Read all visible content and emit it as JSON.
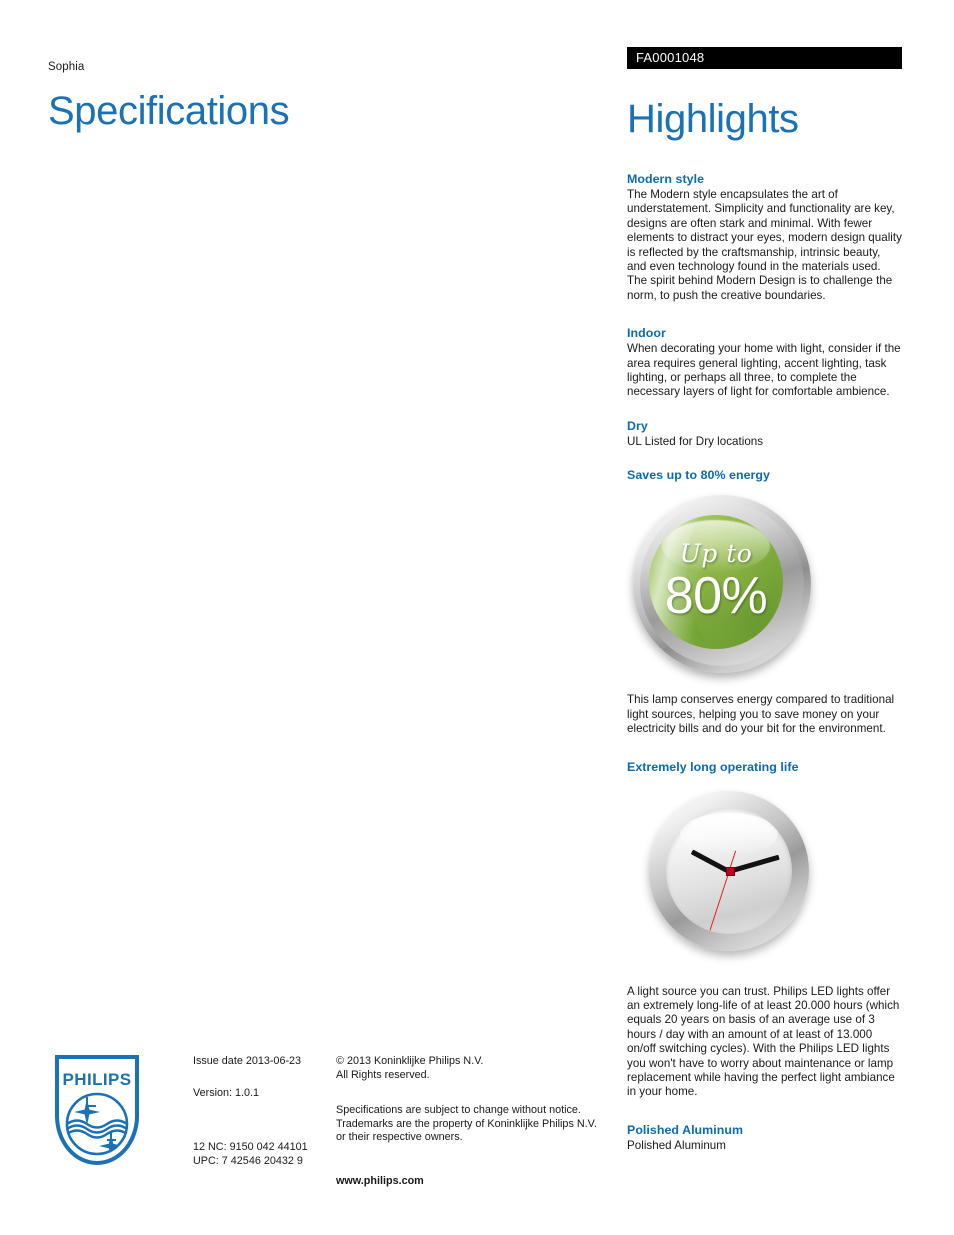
{
  "left": {
    "product_name": "Sophia",
    "title": "Specifications"
  },
  "right": {
    "code": "FA0001048",
    "title": "Highlights",
    "sections": [
      {
        "heading": "Modern style",
        "body": "The Modern style encapsulates the art of understatement. Simplicity and functionality are key, designs are often stark and minimal. With fewer elements to distract your eyes, modern design quality is reflected by the craftsmanship, intrinsic beauty, and even technology found in the materials used. The spirit behind Modern Design is to challenge the norm, to push the creative boundaries."
      },
      {
        "heading": "Indoor",
        "body": "When decorating your home with light, consider if the area requires general lighting, accent lighting, task lighting, or perhaps all three, to complete the necessary layers of light for comfortable ambience."
      },
      {
        "heading": "Dry",
        "body": "UL Listed for Dry locations"
      },
      {
        "heading": "Saves up to 80% energy",
        "body": "This lamp conserves energy compared to traditional light sources, helping you to save money on your electricity bills and do your bit for the environment."
      },
      {
        "heading": "Extremely long operating life",
        "body": "A light source you can trust. Philips LED lights offer an extremely long-life of at least 20.000 hours (which equals 20 years on basis of an average use of 3 hours / day with an amount of at least of 13.000 on/off switching cycles). With the Philips LED lights you won't have to worry about maintenance or lamp replacement while having the perfect light ambiance in your home."
      },
      {
        "heading": "Polished Aluminum",
        "body": "Polished Aluminum"
      }
    ]
  },
  "energy_badge": {
    "upper_text": "Up to",
    "percent_text": "80%"
  },
  "footer": {
    "issue_date": "Issue date 2013-06-23",
    "version": "Version: 1.0.1",
    "nc_code": "12 NC: 9150 042 44101",
    "upc_code": "UPC: 7 42546 20432 9",
    "copyright_line1": "© 2013 Koninklijke Philips N.V.",
    "copyright_line2": "All Rights reserved.",
    "disclaimer_line1": "Specifications are subject to change without notice.",
    "disclaimer_line2": "Trademarks are the property of Koninklijke Philips N.V.",
    "disclaimer_line3": "or their respective owners.",
    "website": "www.philips.com",
    "logo_wordmark": "PHILIPS"
  },
  "colors": {
    "heading_blue": "#0b6ab0",
    "title_blue": "#1b71b5",
    "code_bar_bg": "#000000",
    "code_bar_text": "#ffffff",
    "badge_green_light": "#a9cb52",
    "badge_green_dark": "#5f9129",
    "second_hand_red": "#e0201b",
    "body_text": "#1a1a1a"
  }
}
